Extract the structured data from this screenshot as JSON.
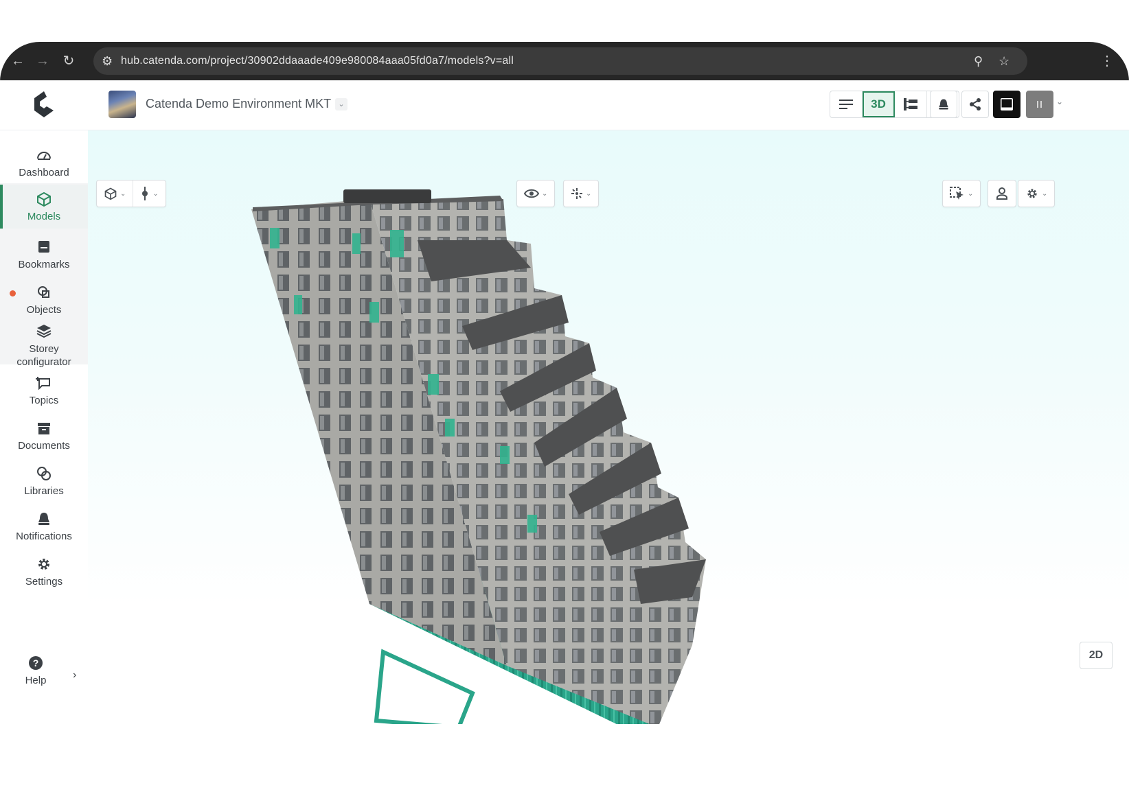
{
  "browser": {
    "url": "hub.catenda.com/project/30902ddaaade409e980084aaa05fd0a7/models?v=all"
  },
  "header": {
    "project_title": "Catenda Demo Environment MKT",
    "view_3d_label": "3D"
  },
  "sidebar": {
    "items": [
      {
        "label": "Dashboard",
        "icon": "gauge-icon"
      },
      {
        "label": "Models",
        "icon": "cube-icon",
        "active": true
      },
      {
        "label": "Bookmarks",
        "icon": "bookmark-icon"
      },
      {
        "label": "Objects",
        "icon": "objects-icon",
        "badge": true
      },
      {
        "label": "Storey configurator",
        "icon": "layers-icon"
      },
      {
        "label": "Topics",
        "icon": "topic-icon"
      },
      {
        "label": "Documents",
        "icon": "archive-icon"
      },
      {
        "label": "Libraries",
        "icon": "library-icon"
      },
      {
        "label": "Notifications",
        "icon": "bell-icon"
      },
      {
        "label": "Settings",
        "icon": "gear-icon"
      }
    ],
    "help_label": "Help"
  },
  "viewer": {
    "toggle_2d_label": "2D"
  },
  "colors": {
    "accent": "#2d8a5f",
    "badge": "#e8613c",
    "model_green": "#2aa58a",
    "facade": "#a7a7a3"
  }
}
